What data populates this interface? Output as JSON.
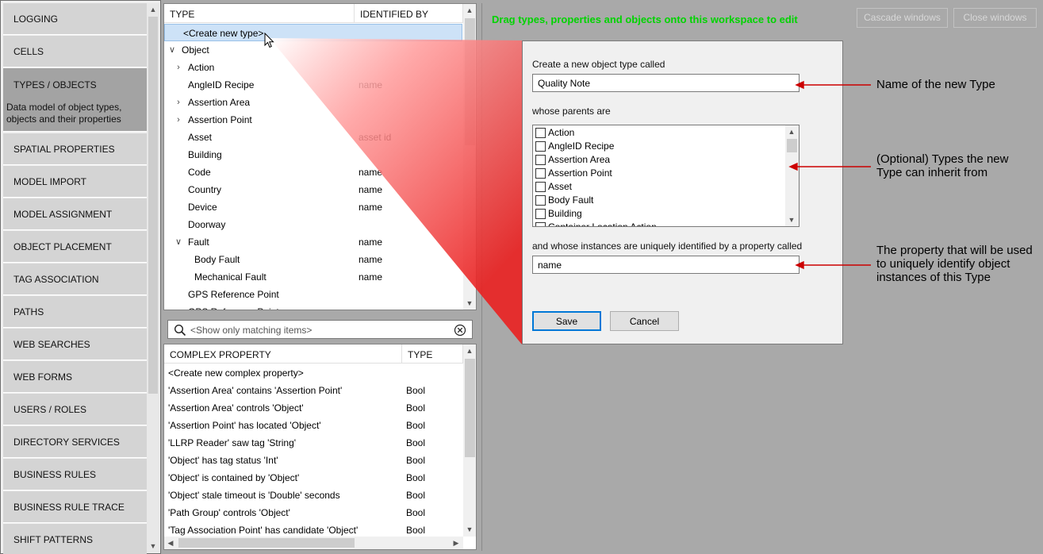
{
  "nav": {
    "items": [
      {
        "label": "LOGGING"
      },
      {
        "label": "CELLS"
      },
      {
        "label": "TYPES / OBJECTS",
        "description": "Data model of object types, objects and their properties",
        "selected": true
      },
      {
        "label": "SPATIAL PROPERTIES"
      },
      {
        "label": "MODEL IMPORT"
      },
      {
        "label": "MODEL ASSIGNMENT"
      },
      {
        "label": "OBJECT PLACEMENT"
      },
      {
        "label": "TAG ASSOCIATION"
      },
      {
        "label": "PATHS"
      },
      {
        "label": "WEB SEARCHES"
      },
      {
        "label": "WEB FORMS"
      },
      {
        "label": "USERS / ROLES"
      },
      {
        "label": "DIRECTORY SERVICES"
      },
      {
        "label": "BUSINESS RULES"
      },
      {
        "label": "BUSINESS RULE TRACE"
      },
      {
        "label": "SHIFT PATTERNS"
      }
    ]
  },
  "types_panel": {
    "headers": {
      "type": "TYPE",
      "identified_by": "IDENTIFIED BY"
    },
    "rows": [
      {
        "name": "<Create new type>",
        "id": "",
        "indent": 1,
        "expander": "",
        "highlight": true
      },
      {
        "name": "Object",
        "id": "",
        "indent": 0,
        "expander": "open"
      },
      {
        "name": "Action",
        "id": "",
        "indent": 1,
        "expander": "closed"
      },
      {
        "name": "AngleID Recipe",
        "id": "name",
        "indent": 1,
        "expander": ""
      },
      {
        "name": "Assertion Area",
        "id": "",
        "indent": 1,
        "expander": "closed"
      },
      {
        "name": "Assertion Point",
        "id": "",
        "indent": 1,
        "expander": "closed"
      },
      {
        "name": "Asset",
        "id": "asset id",
        "indent": 1,
        "expander": ""
      },
      {
        "name": "Building",
        "id": "",
        "indent": 1,
        "expander": ""
      },
      {
        "name": "Code",
        "id": "name",
        "indent": 1,
        "expander": ""
      },
      {
        "name": "Country",
        "id": "name",
        "indent": 1,
        "expander": ""
      },
      {
        "name": "Device",
        "id": "name",
        "indent": 1,
        "expander": ""
      },
      {
        "name": "Doorway",
        "id": "",
        "indent": 1,
        "expander": ""
      },
      {
        "name": "Fault",
        "id": "name",
        "indent": 1,
        "expander": "open"
      },
      {
        "name": "Body Fault",
        "id": "name",
        "indent": 2,
        "expander": ""
      },
      {
        "name": "Mechanical Fault",
        "id": "name",
        "indent": 2,
        "expander": ""
      },
      {
        "name": "GPS Reference Point",
        "id": "",
        "indent": 1,
        "expander": ""
      },
      {
        "name": "GPS Reference Point",
        "id": "",
        "indent": 1,
        "expander": ""
      }
    ]
  },
  "search": {
    "placeholder": "<Show only matching items>"
  },
  "property_panel": {
    "headers": {
      "name": "COMPLEX PROPERTY",
      "type": "TYPE"
    },
    "rows": [
      {
        "name": "<Create new complex property>",
        "type": ""
      },
      {
        "name": "'Assertion Area' contains 'Assertion Point'",
        "type": "Bool"
      },
      {
        "name": "'Assertion Area' controls 'Object'",
        "type": "Bool"
      },
      {
        "name": "'Assertion Point' has located 'Object'",
        "type": "Bool"
      },
      {
        "name": "'LLRP Reader' saw tag 'String'",
        "type": "Bool"
      },
      {
        "name": "'Object' has tag status 'Int'",
        "type": "Bool"
      },
      {
        "name": "'Object' is contained by 'Object'",
        "type": "Bool"
      },
      {
        "name": "'Object' stale timeout is 'Double' seconds",
        "type": "Bool"
      },
      {
        "name": "'Path Group' controls 'Object'",
        "type": "Bool"
      },
      {
        "name": "'Tag Association Point' has candidate 'Object'",
        "type": "Bool"
      }
    ]
  },
  "workspace": {
    "hint": "Drag types, properties and objects onto this workspace to edit",
    "cascade_label": "Cascade windows",
    "close_label": "Close windows"
  },
  "dialog": {
    "name_label": "Create a new object type called",
    "name_value": "Quality Note",
    "parents_label": "whose parents are",
    "parents": [
      "Action",
      "AngleID Recipe",
      "Assertion Area",
      "Assertion Point",
      "Asset",
      "Body Fault",
      "Building",
      "Container Location Action"
    ],
    "identifier_label": "and whose instances are uniquely identified by a property called",
    "identifier_value": "name",
    "save_label": "Save",
    "cancel_label": "Cancel"
  },
  "annotations": {
    "name": "Name of the new Type",
    "parents": "(Optional) Types the new Type can inherit from",
    "identifier": "The property that will be used to uniquely identify object instances of this Type"
  },
  "colors": {
    "hint": "#00d400",
    "arrow": "#cc0000",
    "highlight": "#cde2f7"
  }
}
